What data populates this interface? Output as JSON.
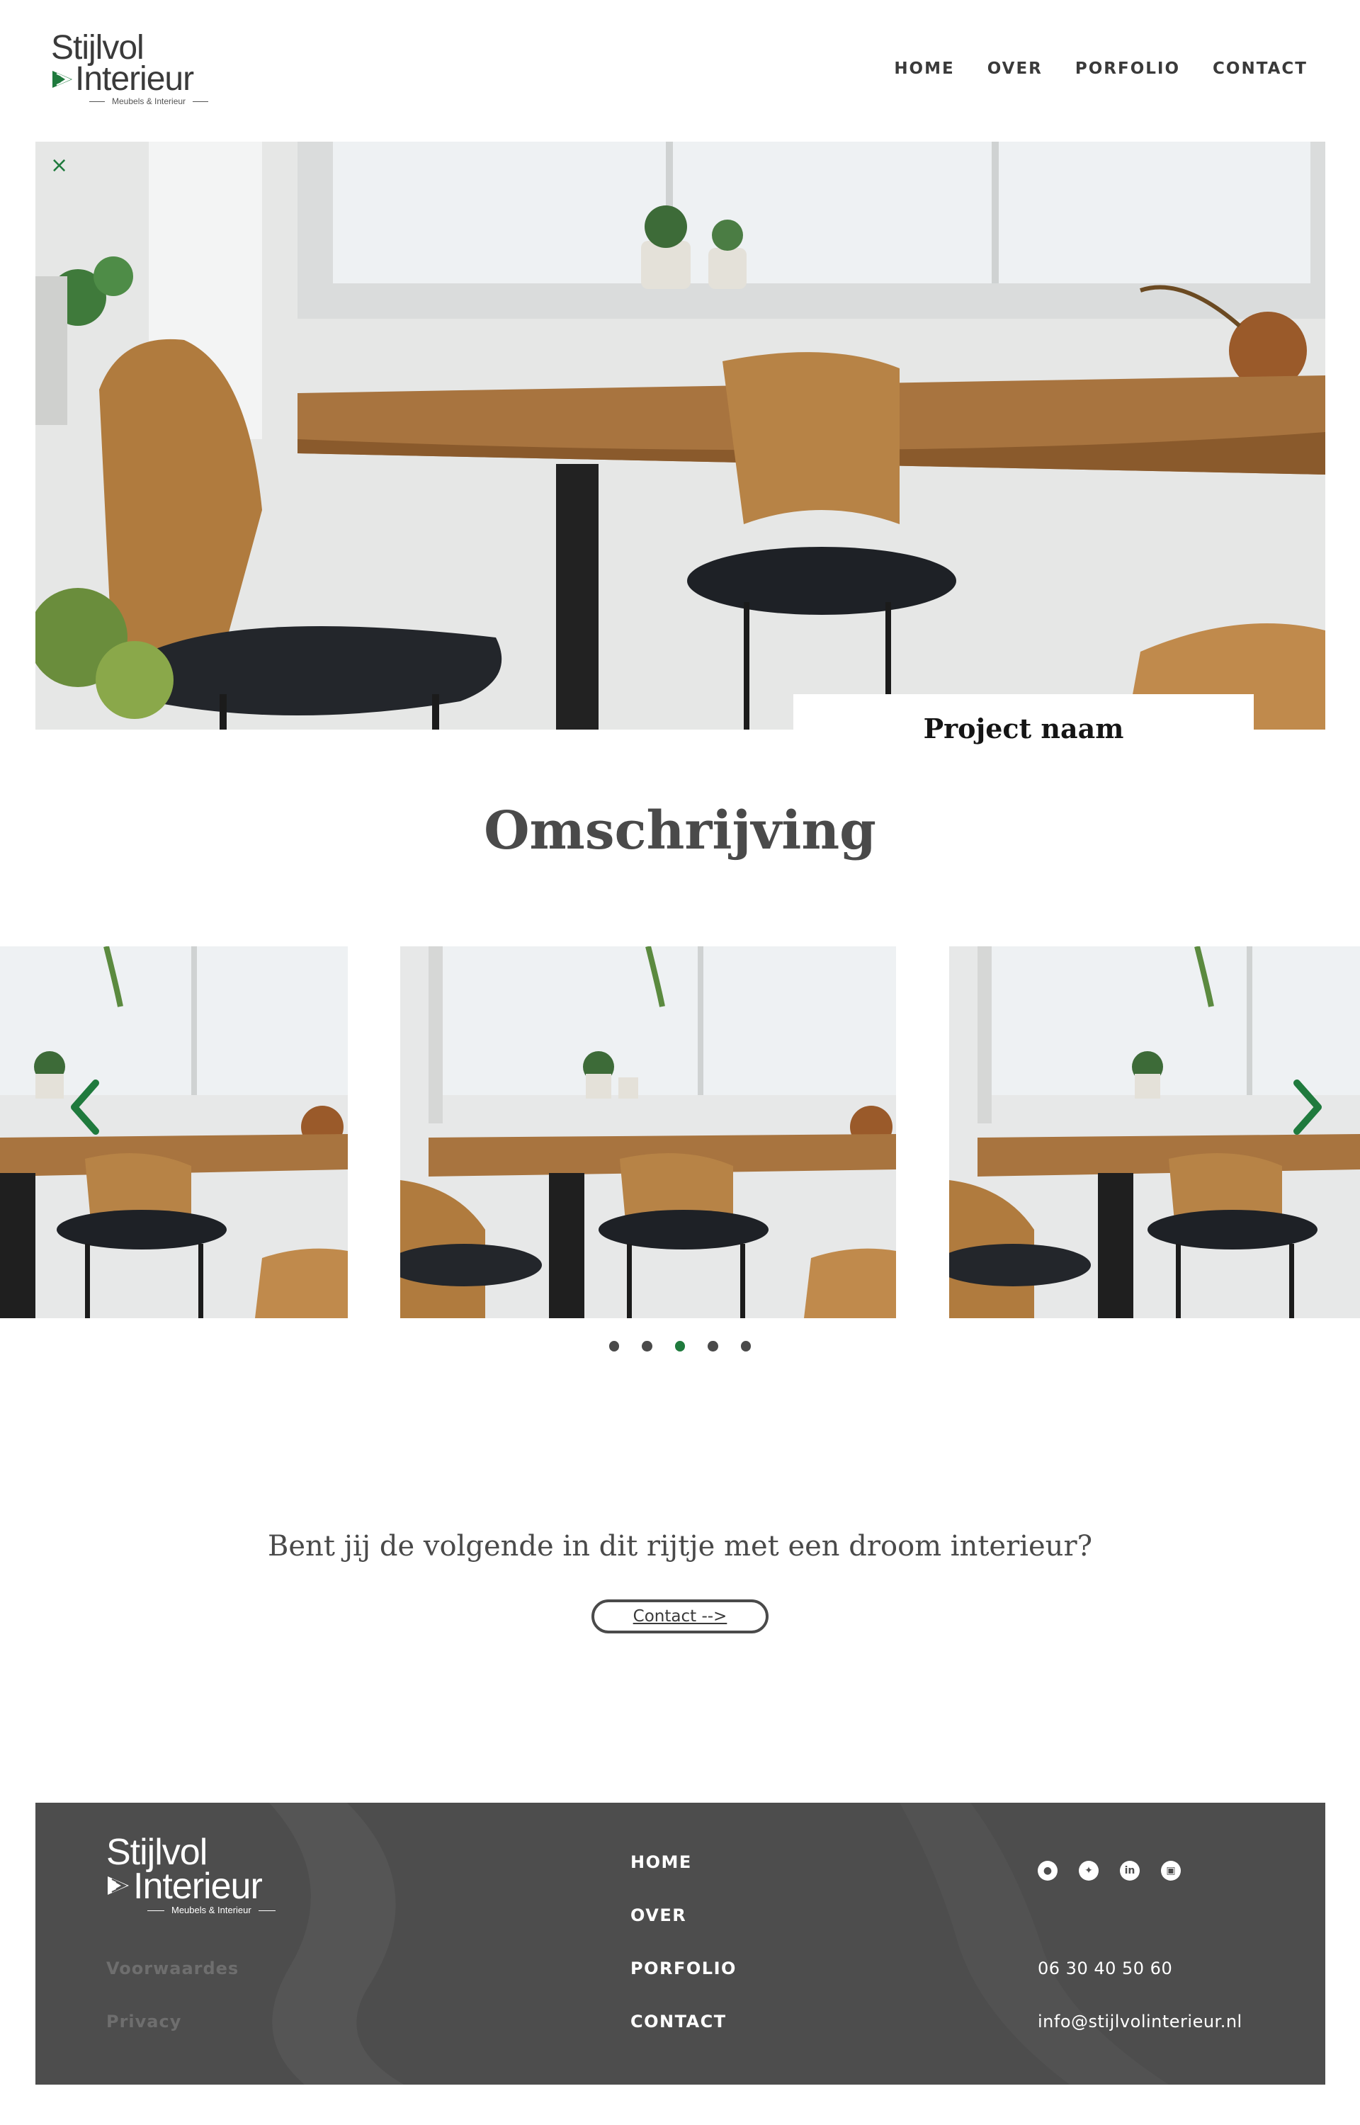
{
  "header": {
    "logo": {
      "line1": "Stijlvol",
      "line2": "Interieur",
      "tagline": "Meubels & Interieur"
    },
    "nav": [
      "HOME",
      "OVER",
      "PORFOLIO",
      "CONTACT"
    ]
  },
  "hero": {
    "close_icon": "×",
    "project_name": "Project naam"
  },
  "section": {
    "title": "Omschrijving"
  },
  "carousel": {
    "slide_count": 5,
    "active_index": 2,
    "accent_color": "#1f7a3d"
  },
  "cta": {
    "text": "Bent jij de volgende in dit rijtje met een droom interieur?",
    "button_label": "Contact  -->"
  },
  "footer": {
    "logo": {
      "line1": "Stijlvol",
      "line2": "Interieur",
      "tagline": "Meubels & Interieur"
    },
    "legal": [
      "Voorwaardes",
      "Privacy"
    ],
    "nav": [
      "HOME",
      "OVER",
      "PORFOLIO",
      "CONTACT"
    ],
    "social_icons": [
      "snapchat-icon",
      "twitter-icon",
      "linkedin-icon",
      "instagram-icon"
    ],
    "phone": "06 30 40 50 60",
    "email": "info@stijlvolinterieur.nl",
    "background": "#4d4d4d"
  }
}
